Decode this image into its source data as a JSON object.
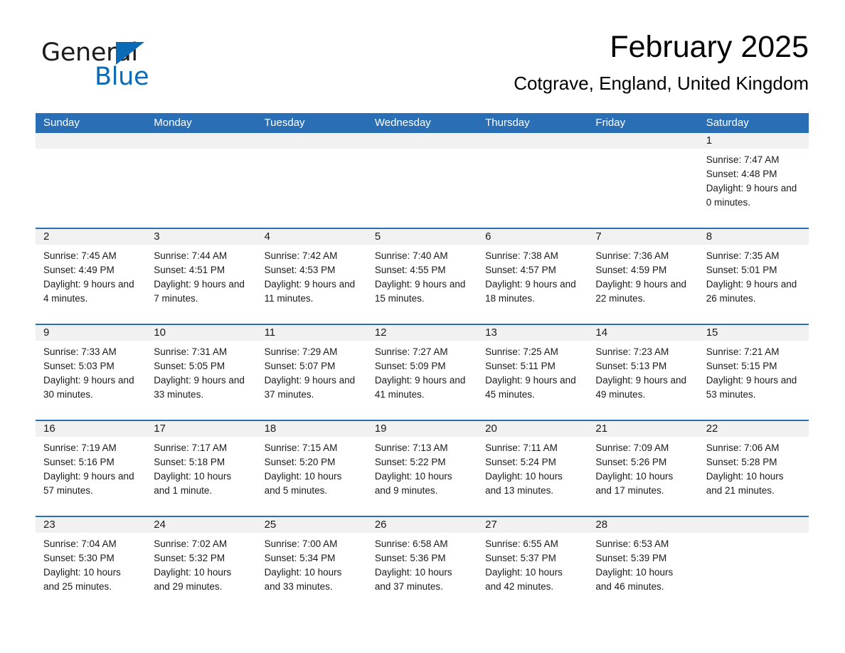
{
  "brand": {
    "name_part1": "General",
    "name_part2": "Blue",
    "triangle_color": "#0a6ab5",
    "text_color": "#1a1a1a"
  },
  "header": {
    "title": "February 2025",
    "subtitle": "Cotgrave, England, United Kingdom"
  },
  "theme": {
    "header_bar_color": "#2a6fb5",
    "row_divider_color": "#2a6fb5",
    "day_band_color": "#f1f1f1",
    "text_color": "#1a1a1a"
  },
  "weekdays": [
    "Sunday",
    "Monday",
    "Tuesday",
    "Wednesday",
    "Thursday",
    "Friday",
    "Saturday"
  ],
  "weeks": [
    [
      {
        "day": "",
        "sunrise": "",
        "sunset": "",
        "daylight": ""
      },
      {
        "day": "",
        "sunrise": "",
        "sunset": "",
        "daylight": ""
      },
      {
        "day": "",
        "sunrise": "",
        "sunset": "",
        "daylight": ""
      },
      {
        "day": "",
        "sunrise": "",
        "sunset": "",
        "daylight": ""
      },
      {
        "day": "",
        "sunrise": "",
        "sunset": "",
        "daylight": ""
      },
      {
        "day": "",
        "sunrise": "",
        "sunset": "",
        "daylight": ""
      },
      {
        "day": "1",
        "sunrise": "Sunrise: 7:47 AM",
        "sunset": "Sunset: 4:48 PM",
        "daylight": "Daylight: 9 hours and 0 minutes."
      }
    ],
    [
      {
        "day": "2",
        "sunrise": "Sunrise: 7:45 AM",
        "sunset": "Sunset: 4:49 PM",
        "daylight": "Daylight: 9 hours and 4 minutes."
      },
      {
        "day": "3",
        "sunrise": "Sunrise: 7:44 AM",
        "sunset": "Sunset: 4:51 PM",
        "daylight": "Daylight: 9 hours and 7 minutes."
      },
      {
        "day": "4",
        "sunrise": "Sunrise: 7:42 AM",
        "sunset": "Sunset: 4:53 PM",
        "daylight": "Daylight: 9 hours and 11 minutes."
      },
      {
        "day": "5",
        "sunrise": "Sunrise: 7:40 AM",
        "sunset": "Sunset: 4:55 PM",
        "daylight": "Daylight: 9 hours and 15 minutes."
      },
      {
        "day": "6",
        "sunrise": "Sunrise: 7:38 AM",
        "sunset": "Sunset: 4:57 PM",
        "daylight": "Daylight: 9 hours and 18 minutes."
      },
      {
        "day": "7",
        "sunrise": "Sunrise: 7:36 AM",
        "sunset": "Sunset: 4:59 PM",
        "daylight": "Daylight: 9 hours and 22 minutes."
      },
      {
        "day": "8",
        "sunrise": "Sunrise: 7:35 AM",
        "sunset": "Sunset: 5:01 PM",
        "daylight": "Daylight: 9 hours and 26 minutes."
      }
    ],
    [
      {
        "day": "9",
        "sunrise": "Sunrise: 7:33 AM",
        "sunset": "Sunset: 5:03 PM",
        "daylight": "Daylight: 9 hours and 30 minutes."
      },
      {
        "day": "10",
        "sunrise": "Sunrise: 7:31 AM",
        "sunset": "Sunset: 5:05 PM",
        "daylight": "Daylight: 9 hours and 33 minutes."
      },
      {
        "day": "11",
        "sunrise": "Sunrise: 7:29 AM",
        "sunset": "Sunset: 5:07 PM",
        "daylight": "Daylight: 9 hours and 37 minutes."
      },
      {
        "day": "12",
        "sunrise": "Sunrise: 7:27 AM",
        "sunset": "Sunset: 5:09 PM",
        "daylight": "Daylight: 9 hours and 41 minutes."
      },
      {
        "day": "13",
        "sunrise": "Sunrise: 7:25 AM",
        "sunset": "Sunset: 5:11 PM",
        "daylight": "Daylight: 9 hours and 45 minutes."
      },
      {
        "day": "14",
        "sunrise": "Sunrise: 7:23 AM",
        "sunset": "Sunset: 5:13 PM",
        "daylight": "Daylight: 9 hours and 49 minutes."
      },
      {
        "day": "15",
        "sunrise": "Sunrise: 7:21 AM",
        "sunset": "Sunset: 5:15 PM",
        "daylight": "Daylight: 9 hours and 53 minutes."
      }
    ],
    [
      {
        "day": "16",
        "sunrise": "Sunrise: 7:19 AM",
        "sunset": "Sunset: 5:16 PM",
        "daylight": "Daylight: 9 hours and 57 minutes."
      },
      {
        "day": "17",
        "sunrise": "Sunrise: 7:17 AM",
        "sunset": "Sunset: 5:18 PM",
        "daylight": "Daylight: 10 hours and 1 minute."
      },
      {
        "day": "18",
        "sunrise": "Sunrise: 7:15 AM",
        "sunset": "Sunset: 5:20 PM",
        "daylight": "Daylight: 10 hours and 5 minutes."
      },
      {
        "day": "19",
        "sunrise": "Sunrise: 7:13 AM",
        "sunset": "Sunset: 5:22 PM",
        "daylight": "Daylight: 10 hours and 9 minutes."
      },
      {
        "day": "20",
        "sunrise": "Sunrise: 7:11 AM",
        "sunset": "Sunset: 5:24 PM",
        "daylight": "Daylight: 10 hours and 13 minutes."
      },
      {
        "day": "21",
        "sunrise": "Sunrise: 7:09 AM",
        "sunset": "Sunset: 5:26 PM",
        "daylight": "Daylight: 10 hours and 17 minutes."
      },
      {
        "day": "22",
        "sunrise": "Sunrise: 7:06 AM",
        "sunset": "Sunset: 5:28 PM",
        "daylight": "Daylight: 10 hours and 21 minutes."
      }
    ],
    [
      {
        "day": "23",
        "sunrise": "Sunrise: 7:04 AM",
        "sunset": "Sunset: 5:30 PM",
        "daylight": "Daylight: 10 hours and 25 minutes."
      },
      {
        "day": "24",
        "sunrise": "Sunrise: 7:02 AM",
        "sunset": "Sunset: 5:32 PM",
        "daylight": "Daylight: 10 hours and 29 minutes."
      },
      {
        "day": "25",
        "sunrise": "Sunrise: 7:00 AM",
        "sunset": "Sunset: 5:34 PM",
        "daylight": "Daylight: 10 hours and 33 minutes."
      },
      {
        "day": "26",
        "sunrise": "Sunrise: 6:58 AM",
        "sunset": "Sunset: 5:36 PM",
        "daylight": "Daylight: 10 hours and 37 minutes."
      },
      {
        "day": "27",
        "sunrise": "Sunrise: 6:55 AM",
        "sunset": "Sunset: 5:37 PM",
        "daylight": "Daylight: 10 hours and 42 minutes."
      },
      {
        "day": "28",
        "sunrise": "Sunrise: 6:53 AM",
        "sunset": "Sunset: 5:39 PM",
        "daylight": "Daylight: 10 hours and 46 minutes."
      },
      {
        "day": "",
        "sunrise": "",
        "sunset": "",
        "daylight": ""
      }
    ]
  ]
}
